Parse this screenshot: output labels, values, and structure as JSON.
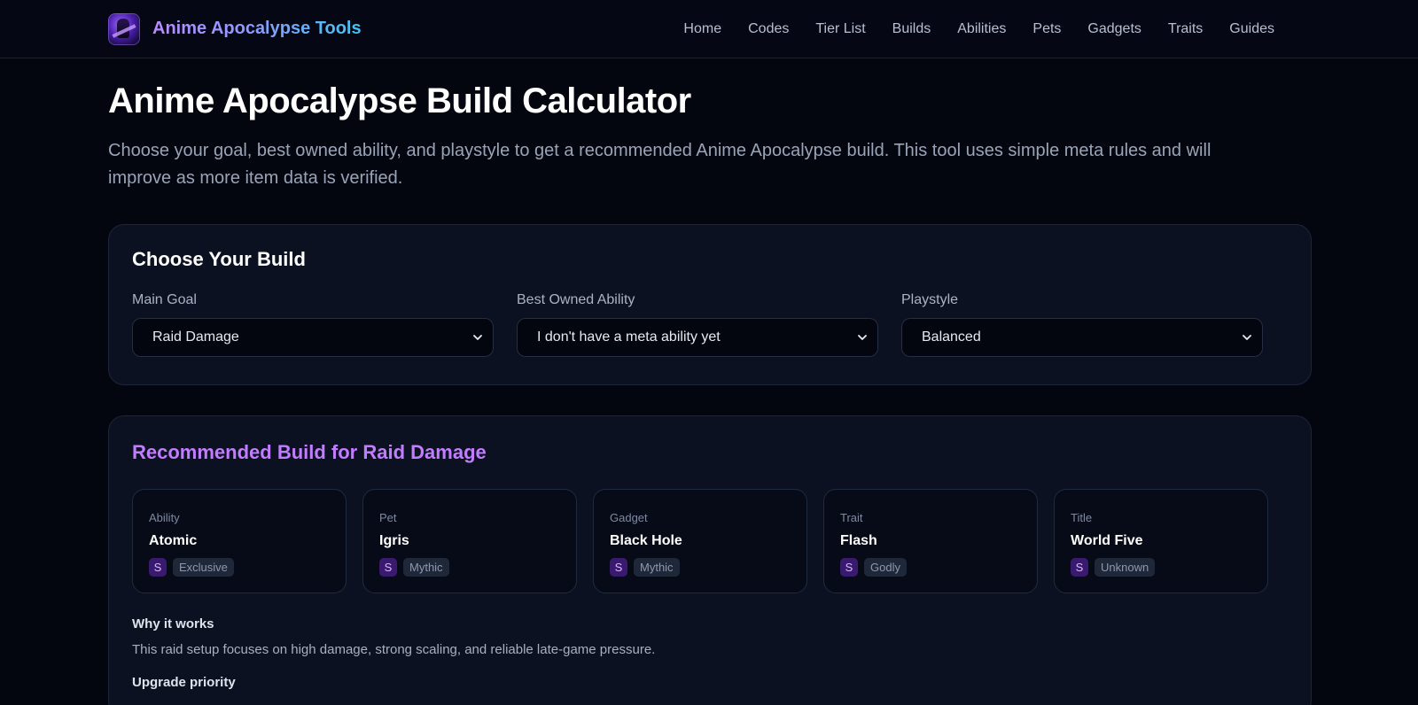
{
  "header": {
    "brand": "Anime Apocalypse Tools",
    "nav": [
      "Home",
      "Codes",
      "Tier List",
      "Builds",
      "Abilities",
      "Pets",
      "Gadgets",
      "Traits",
      "Guides"
    ]
  },
  "page": {
    "title": "Anime Apocalypse Build Calculator",
    "intro": "Choose your goal, best owned ability, and playstyle to get a recommended Anime Apocalypse build. This tool uses simple meta rules and will improve as more item data is verified."
  },
  "choose": {
    "title": "Choose Your Build",
    "fields": [
      {
        "label": "Main Goal",
        "value": "Raid Damage"
      },
      {
        "label": "Best Owned Ability",
        "value": "I don't have a meta ability yet"
      },
      {
        "label": "Playstyle",
        "value": "Balanced"
      }
    ]
  },
  "recommend": {
    "title": "Recommended Build for Raid Damage",
    "cards": [
      {
        "kind": "Ability",
        "name": "Atomic",
        "tier": "S",
        "rarity": "Exclusive"
      },
      {
        "kind": "Pet",
        "name": "Igris",
        "tier": "S",
        "rarity": "Mythic"
      },
      {
        "kind": "Gadget",
        "name": "Black Hole",
        "tier": "S",
        "rarity": "Mythic"
      },
      {
        "kind": "Trait",
        "name": "Flash",
        "tier": "S",
        "rarity": "Godly"
      },
      {
        "kind": "Title",
        "name": "World Five",
        "tier": "S",
        "rarity": "Unknown"
      }
    ],
    "why_heading": "Why it works",
    "why_text": "This raid setup focuses on high damage, strong scaling, and reliable late-game pressure.",
    "upgrade_heading": "Upgrade priority"
  },
  "colors": {
    "background": "#03060f",
    "panel": "#0b1120",
    "accent_purple": "#c27cff",
    "brand_gradient_start": "#b98bff",
    "brand_gradient_end": "#3fc6f2"
  },
  "icons": {
    "logo": "anime-character-logo-icon",
    "select_arrow": "chevron-down-icon"
  }
}
